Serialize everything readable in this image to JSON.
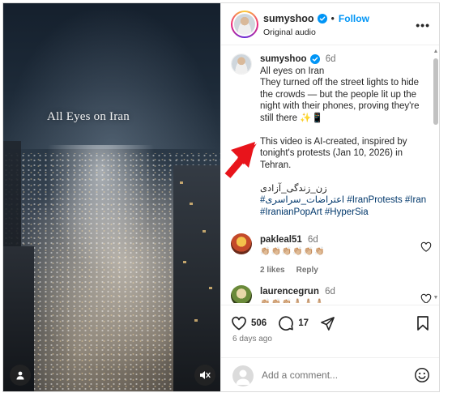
{
  "video": {
    "overlay_text": "All Eyes on Iran"
  },
  "header": {
    "username": "sumyshoo",
    "follow_label": "Follow",
    "audio_label": "Original audio"
  },
  "caption": {
    "username": "sumyshoo",
    "age": "6d",
    "lines": [
      "All eyes on Iran",
      "They turned off the street lights to hide the crowds — but the people lit up the night with their phones, proving they're still there ✨📱",
      "This video is AI-created, inspired by tonight's protests (Jan 10, 2026) in Tehran."
    ],
    "persian": "زن_زندگی_آزادی",
    "hashtags_line1": "#اعتراضات_سراسری #IranProtests #Iran",
    "hashtags_line2": "#IranianPopArt #HyperSia"
  },
  "comments": [
    {
      "username": "pakleal51",
      "age": "6d",
      "text": "👏🏼👏🏼👏🏼👏🏼👏🏼👏🏼",
      "likes": "2 likes",
      "reply_label": "Reply"
    },
    {
      "username": "laurencegrun",
      "age": "6d",
      "text": "👏🏼👏🏼👏🏼🙏🏼🙏🏼🙏🏼"
    }
  ],
  "actions": {
    "like_count": "506",
    "comment_count": "17",
    "posted": "6 days ago"
  },
  "add_comment": {
    "placeholder": "Add a comment..."
  },
  "colors": {
    "link_blue": "#0095f6",
    "hashtag": "#00376b",
    "annotation_red": "#e8141b"
  }
}
